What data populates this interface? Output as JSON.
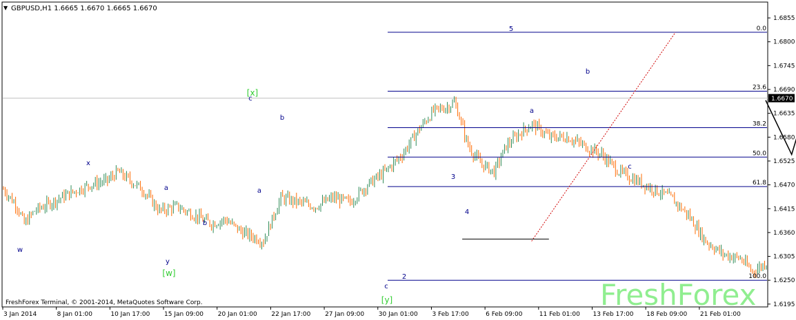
{
  "chart_data": {
    "type": "candlestick",
    "title": "GBPUSD,H1  1.6665 1.6670 1.6665 1.6670",
    "symbol": "GBPUSD,H1",
    "ohlc_header": "1.6665 1.6670 1.6665 1.6670",
    "footer": "FreshForex Terminal, © 2001-2014, MetaQuotes Software Corp.",
    "watermark": "FreshForex",
    "current_price": "1.6670",
    "ylim": [
      1.619,
      1.689
    ],
    "y_ticks": [
      "1.6855",
      "1.6800",
      "1.6745",
      "1.6690",
      "1.6635",
      "1.6580",
      "1.6525",
      "1.6470",
      "1.6415",
      "1.6360",
      "1.6305",
      "1.6250",
      "1.6195"
    ],
    "x_ticks": [
      "3 Jan 2014",
      "8 Jan 01:00",
      "10 Jan 17:00",
      "15 Jan 09:00",
      "20 Jan 01:00",
      "22 Jan 17:00",
      "27 Jan 09:00",
      "30 Jan 01:00",
      "3 Feb 17:00",
      "6 Feb 09:00",
      "11 Feb 01:00",
      "13 Feb 17:00",
      "18 Feb 09:00",
      "21 Feb 01:00"
    ],
    "bar_index_range": [
      0,
      440
    ],
    "path_points": [
      [
        0,
        1.646
      ],
      [
        8,
        1.642
      ],
      [
        12,
        1.638
      ],
      [
        18,
        1.641
      ],
      [
        28,
        1.643
      ],
      [
        38,
        1.645
      ],
      [
        50,
        1.647
      ],
      [
        60,
        1.648
      ],
      [
        66,
        1.65
      ],
      [
        80,
        1.646
      ],
      [
        90,
        1.641
      ],
      [
        100,
        1.642
      ],
      [
        110,
        1.64
      ],
      [
        120,
        1.638
      ],
      [
        128,
        1.639
      ],
      [
        138,
        1.636
      ],
      [
        150,
        1.634
      ],
      [
        160,
        1.644
      ],
      [
        170,
        1.643
      ],
      [
        180,
        1.642
      ],
      [
        190,
        1.644
      ],
      [
        200,
        1.643
      ],
      [
        210,
        1.647
      ],
      [
        220,
        1.65
      ],
      [
        230,
        1.654
      ],
      [
        240,
        1.66
      ],
      [
        248,
        1.664
      ],
      [
        256,
        1.665
      ],
      [
        260,
        1.666
      ],
      [
        262,
        1.664
      ],
      [
        268,
        1.656
      ],
      [
        275,
        1.652
      ],
      [
        283,
        1.65
      ],
      [
        290,
        1.656
      ],
      [
        298,
        1.659
      ],
      [
        305,
        1.661
      ],
      [
        315,
        1.658
      ],
      [
        325,
        1.658
      ],
      [
        335,
        1.656
      ],
      [
        345,
        1.654
      ],
      [
        355,
        1.65
      ],
      [
        365,
        1.648
      ],
      [
        375,
        1.646
      ],
      [
        385,
        1.644
      ],
      [
        395,
        1.64
      ],
      [
        405,
        1.634
      ],
      [
        415,
        1.631
      ],
      [
        425,
        1.63
      ],
      [
        432,
        1.627
      ],
      [
        440,
        1.629
      ]
    ],
    "fibonacci": {
      "levels": [
        {
          "label": "0.0",
          "price": 1.6822
        },
        {
          "label": "23.6",
          "price": 1.6686
        },
        {
          "label": "38.2",
          "price": 1.6602
        },
        {
          "label": "50.0",
          "price": 1.6534
        },
        {
          "label": "61.8",
          "price": 1.6466
        },
        {
          "label": "100.0",
          "price": 1.625
        }
      ]
    },
    "wave_labels_blue": [
      "w",
      "x",
      "y",
      "a",
      "b",
      "c",
      "b",
      "a",
      "c",
      "2",
      "3",
      "4",
      "5",
      "a",
      "b",
      "c"
    ],
    "wave_labels_green": [
      "[w]",
      "[x]",
      "[y]"
    ]
  }
}
